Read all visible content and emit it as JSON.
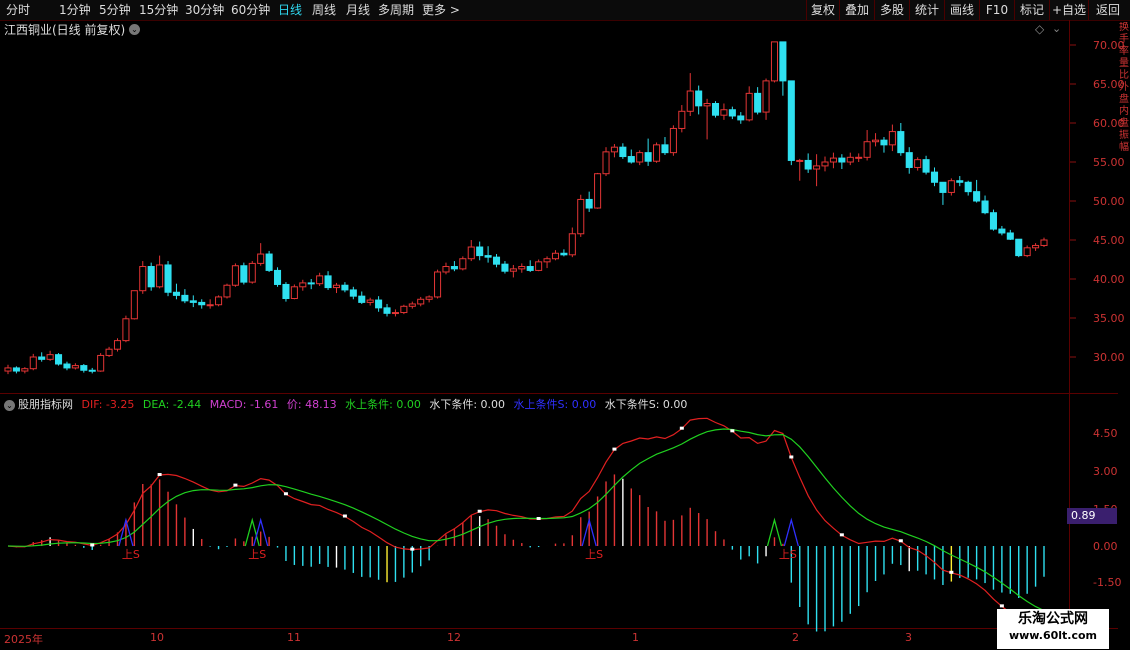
{
  "toolbar": {
    "periods": [
      "分时",
      "1分钟",
      "5分钟",
      "15分钟",
      "30分钟",
      "60分钟",
      "日线",
      "周线",
      "月线",
      "多周期",
      "更多 >"
    ],
    "active_period": "日线",
    "right_buttons": [
      "复权",
      "叠加",
      "多股",
      "统计",
      "画线",
      "F10",
      "标记",
      "+自选",
      "返回"
    ]
  },
  "stock": {
    "title": "江西铜业(日线 前复权)"
  },
  "indicator": {
    "name": "股朋指标网",
    "dif": "DIF: -3.25",
    "dea": "DEA: -2.44",
    "macd": "MACD: -1.61",
    "price": "价: 48.13",
    "cond_up": "水上条件: 0.00",
    "cond_down": "水下条件: 0.00",
    "cond_up_s": "水上条件S: 0.00",
    "cond_down_s": "水下条件S: 0.00",
    "current_value": "0.89",
    "marker_text": "上S"
  },
  "price_axis": [
    "70.00",
    "65.00",
    "60.00",
    "55.00",
    "50.00",
    "45.00",
    "40.00",
    "35.00",
    "30.00"
  ],
  "macd_axis": [
    "4.50",
    "3.00",
    "1.50",
    "0.00",
    "-1.50"
  ],
  "x_axis": [
    "2025年",
    "10",
    "11",
    "12",
    "1",
    "2",
    "3"
  ],
  "side_text": "换手率量比外盘内盘振幅",
  "colors": {
    "up": "#e33535",
    "down": "#2fe0f0",
    "dif": "#e02020",
    "dea": "#20d020",
    "macd": "#d040d0",
    "up_s": "#3030ff"
  },
  "watermark": {
    "title": "乐淘公式网",
    "url": "www.60lt.com"
  },
  "chart_data": {
    "type": "candlestick",
    "series": [
      {
        "name": "K线",
        "ohlc": [
          [
            28.2,
            29.0,
            27.8,
            28.6
          ],
          [
            28.6,
            28.8,
            27.9,
            28.2
          ],
          [
            28.2,
            28.7,
            27.9,
            28.5
          ],
          [
            28.5,
            30.4,
            28.3,
            30.0
          ],
          [
            30.0,
            30.6,
            29.4,
            29.7
          ],
          [
            29.7,
            30.8,
            29.5,
            30.3
          ],
          [
            30.3,
            30.5,
            28.9,
            29.1
          ],
          [
            29.1,
            29.4,
            28.3,
            28.6
          ],
          [
            28.6,
            29.2,
            28.4,
            28.9
          ],
          [
            28.9,
            29.1,
            28.0,
            28.3
          ],
          [
            28.3,
            28.6,
            27.9,
            28.2
          ],
          [
            28.2,
            30.5,
            28.1,
            30.2
          ],
          [
            30.2,
            31.3,
            30.0,
            31.0
          ],
          [
            31.0,
            32.4,
            30.7,
            32.1
          ],
          [
            32.1,
            35.3,
            31.9,
            34.9
          ],
          [
            34.9,
            38.5,
            34.8,
            38.5
          ],
          [
            38.5,
            42.3,
            38.1,
            41.6
          ],
          [
            41.6,
            42.1,
            38.5,
            39.0
          ],
          [
            39.0,
            43.0,
            38.8,
            41.8
          ],
          [
            41.8,
            42.3,
            37.8,
            38.3
          ],
          [
            38.3,
            39.4,
            37.4,
            37.9
          ],
          [
            37.9,
            38.7,
            36.9,
            37.2
          ],
          [
            37.2,
            37.9,
            36.4,
            37.0
          ],
          [
            37.0,
            37.4,
            36.2,
            36.7
          ],
          [
            36.7,
            37.4,
            36.2,
            36.7
          ],
          [
            36.7,
            37.9,
            36.5,
            37.7
          ],
          [
            37.7,
            39.4,
            37.5,
            39.2
          ],
          [
            39.2,
            42.0,
            39.0,
            41.7
          ],
          [
            41.7,
            42.1,
            39.3,
            39.6
          ],
          [
            39.6,
            42.3,
            39.4,
            42.0
          ],
          [
            42.0,
            44.6,
            41.7,
            43.2
          ],
          [
            43.2,
            43.6,
            40.9,
            41.1
          ],
          [
            41.1,
            41.5,
            39.0,
            39.3
          ],
          [
            39.3,
            39.6,
            37.1,
            37.5
          ],
          [
            37.5,
            39.3,
            37.4,
            39.0
          ],
          [
            39.0,
            39.9,
            38.5,
            39.5
          ],
          [
            39.5,
            40.0,
            38.7,
            39.4
          ],
          [
            39.4,
            40.8,
            39.1,
            40.4
          ],
          [
            40.4,
            41.0,
            38.6,
            38.9
          ],
          [
            38.9,
            39.5,
            38.2,
            39.2
          ],
          [
            39.2,
            39.6,
            38.3,
            38.6
          ],
          [
            38.6,
            39.0,
            37.4,
            37.8
          ],
          [
            37.8,
            38.4,
            36.8,
            37.0
          ],
          [
            37.0,
            37.6,
            36.6,
            37.3
          ],
          [
            37.3,
            37.8,
            35.8,
            36.3
          ],
          [
            36.3,
            36.8,
            35.2,
            35.6
          ],
          [
            35.6,
            36.1,
            35.2,
            35.7
          ],
          [
            35.7,
            36.7,
            35.5,
            36.5
          ],
          [
            36.5,
            37.1,
            36.2,
            36.8
          ],
          [
            36.8,
            37.7,
            36.5,
            37.4
          ],
          [
            37.4,
            37.9,
            37.0,
            37.7
          ],
          [
            37.7,
            41.2,
            37.5,
            40.9
          ],
          [
            40.9,
            42.1,
            40.6,
            41.6
          ],
          [
            41.6,
            42.3,
            41.0,
            41.3
          ],
          [
            41.3,
            42.9,
            41.1,
            42.6
          ],
          [
            42.6,
            45.0,
            42.3,
            44.1
          ],
          [
            44.1,
            44.8,
            42.4,
            43.0
          ],
          [
            43.0,
            44.2,
            42.1,
            42.8
          ],
          [
            42.8,
            43.2,
            41.5,
            41.9
          ],
          [
            41.9,
            42.3,
            40.7,
            41.0
          ],
          [
            41.0,
            41.8,
            40.2,
            41.3
          ],
          [
            41.3,
            42.0,
            40.8,
            41.6
          ],
          [
            41.6,
            42.4,
            40.9,
            41.1
          ],
          [
            41.1,
            42.5,
            41.0,
            42.2
          ],
          [
            42.2,
            42.9,
            41.4,
            42.6
          ],
          [
            42.6,
            43.7,
            42.4,
            43.3
          ],
          [
            43.3,
            43.8,
            42.9,
            43.1
          ],
          [
            43.1,
            46.6,
            42.8,
            45.8
          ],
          [
            45.8,
            50.8,
            45.4,
            50.2
          ],
          [
            50.2,
            51.2,
            48.6,
            49.1
          ],
          [
            49.1,
            53.6,
            49.0,
            53.5
          ],
          [
            53.5,
            56.9,
            53.2,
            56.3
          ],
          [
            56.3,
            57.3,
            55.6,
            56.9
          ],
          [
            56.9,
            57.4,
            55.4,
            55.7
          ],
          [
            55.7,
            56.6,
            54.8,
            55.0
          ],
          [
            55.0,
            56.5,
            54.6,
            56.2
          ],
          [
            56.2,
            58.0,
            54.5,
            55.1
          ],
          [
            55.1,
            57.5,
            54.9,
            57.2
          ],
          [
            57.2,
            58.2,
            55.9,
            56.2
          ],
          [
            56.2,
            59.7,
            55.8,
            59.3
          ],
          [
            59.3,
            62.3,
            58.8,
            61.5
          ],
          [
            61.5,
            66.4,
            60.9,
            64.1
          ],
          [
            64.1,
            64.8,
            61.1,
            62.2
          ],
          [
            62.2,
            63.1,
            57.9,
            62.5
          ],
          [
            62.5,
            62.8,
            60.7,
            61.0
          ],
          [
            61.0,
            62.5,
            60.4,
            61.7
          ],
          [
            61.7,
            62.1,
            60.5,
            60.9
          ],
          [
            60.9,
            61.4,
            59.9,
            60.4
          ],
          [
            60.4,
            64.7,
            60.2,
            63.8
          ],
          [
            63.8,
            64.6,
            61.1,
            61.4
          ],
          [
            61.4,
            65.7,
            60.4,
            65.4
          ],
          [
            65.4,
            70.4,
            65.2,
            70.4
          ],
          [
            70.4,
            67.8,
            63.5,
            65.4
          ],
          [
            65.4,
            61.1,
            54.6,
            55.2
          ],
          [
            55.2,
            55.4,
            52.6,
            55.2
          ],
          [
            55.2,
            56.1,
            53.6,
            54.1
          ],
          [
            54.1,
            56.0,
            51.9,
            54.5
          ],
          [
            54.5,
            55.7,
            53.8,
            55.0
          ],
          [
            55.0,
            56.2,
            54.2,
            55.5
          ],
          [
            55.5,
            56.0,
            54.1,
            55.0
          ],
          [
            55.0,
            56.2,
            54.6,
            55.6
          ],
          [
            55.6,
            56.1,
            55.0,
            55.6
          ],
          [
            55.6,
            59.1,
            55.2,
            57.6
          ],
          [
            57.6,
            58.7,
            57.0,
            57.8
          ],
          [
            57.8,
            58.2,
            56.2,
            57.2
          ],
          [
            57.2,
            59.8,
            56.4,
            58.9
          ],
          [
            58.9,
            60.0,
            55.8,
            56.2
          ],
          [
            56.2,
            56.9,
            53.5,
            54.3
          ],
          [
            54.3,
            55.6,
            53.9,
            55.3
          ],
          [
            55.3,
            55.8,
            53.4,
            53.7
          ],
          [
            53.7,
            54.3,
            51.9,
            52.4
          ],
          [
            52.4,
            51.6,
            49.5,
            51.1
          ],
          [
            51.1,
            52.9,
            50.7,
            52.6
          ],
          [
            52.6,
            53.2,
            51.9,
            52.4
          ],
          [
            52.4,
            52.6,
            50.7,
            51.2
          ],
          [
            51.2,
            52.7,
            49.8,
            50.0
          ],
          [
            50.0,
            50.7,
            48.3,
            48.5
          ],
          [
            48.5,
            48.9,
            46.2,
            46.4
          ],
          [
            46.4,
            46.8,
            45.6,
            45.9
          ],
          [
            45.9,
            46.3,
            45.0,
            45.1
          ],
          [
            45.1,
            44.1,
            42.8,
            43.0
          ],
          [
            43.0,
            44.3,
            42.8,
            44.0
          ],
          [
            44.0,
            44.6,
            43.6,
            44.3
          ],
          [
            44.3,
            45.3,
            44.1,
            45.0
          ]
        ]
      }
    ],
    "ylim": [
      26,
      72
    ]
  }
}
